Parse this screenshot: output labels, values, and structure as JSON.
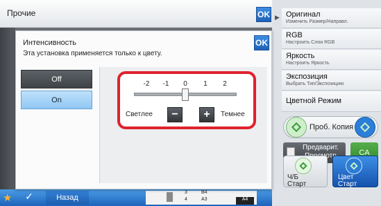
{
  "header": {
    "title": "Прочие",
    "ok_label": "OK"
  },
  "dialog": {
    "title": "Интенсивность",
    "subtitle": "Эта установка применяется только к цвету.",
    "ok_label": "OK",
    "options": [
      {
        "label": "Off",
        "selected": false
      },
      {
        "label": "On",
        "selected": true
      }
    ],
    "slider": {
      "ticks": [
        "-2",
        "-1",
        "0",
        "1",
        "2"
      ],
      "value": 0,
      "lighter_label": "Светлее",
      "darker_label": "Темнее",
      "minus_label": "−",
      "plus_label": "+"
    }
  },
  "sidebar": {
    "items": [
      {
        "label": "Оригинал",
        "sub": "Изменить Размер/Направл."
      },
      {
        "label": "RGB",
        "sub": "Настроить Слои RGB"
      },
      {
        "label": "Яркость",
        "sub": "Настроить Яркость"
      },
      {
        "label": "Экспозиция",
        "sub": "Выбрать Тип/Экспозицию"
      },
      {
        "label": "Цветной Режим",
        "sub": ""
      }
    ],
    "proof_copy": "Проб. Копия",
    "preview": "Предварит.\nПросмотр",
    "ca": "CA",
    "bw_start": "Ч/Б\nСтарт",
    "color_start": "Цвет\nСтарт"
  },
  "bottom": {
    "back_label": "Назад",
    "paper": [
      "3",
      "B4",
      "4",
      "A3",
      "A4"
    ]
  },
  "colors": {
    "accent": "#1f62b9",
    "highlight": "#e0222e",
    "selected": "#8fc8f3"
  }
}
